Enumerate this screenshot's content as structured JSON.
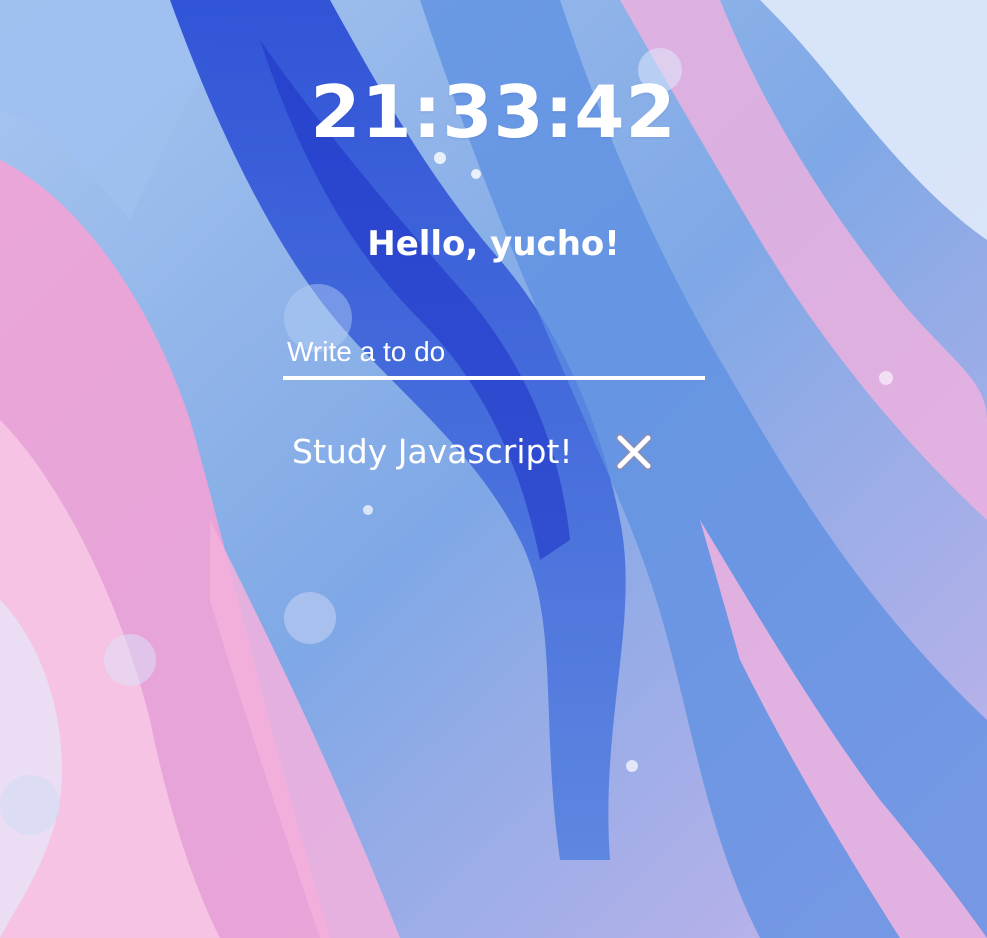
{
  "clock": {
    "time": "21:33:42"
  },
  "greeting": {
    "text": "Hello, yucho!"
  },
  "todo_form": {
    "placeholder": "Write a to do",
    "value": ""
  },
  "todos": [
    {
      "text": "Study Javascript!",
      "delete_icon": "close-icon"
    }
  ],
  "background": {
    "description_colors": [
      "#2f58d8",
      "#8fb5e8",
      "#f3a8d8"
    ]
  }
}
